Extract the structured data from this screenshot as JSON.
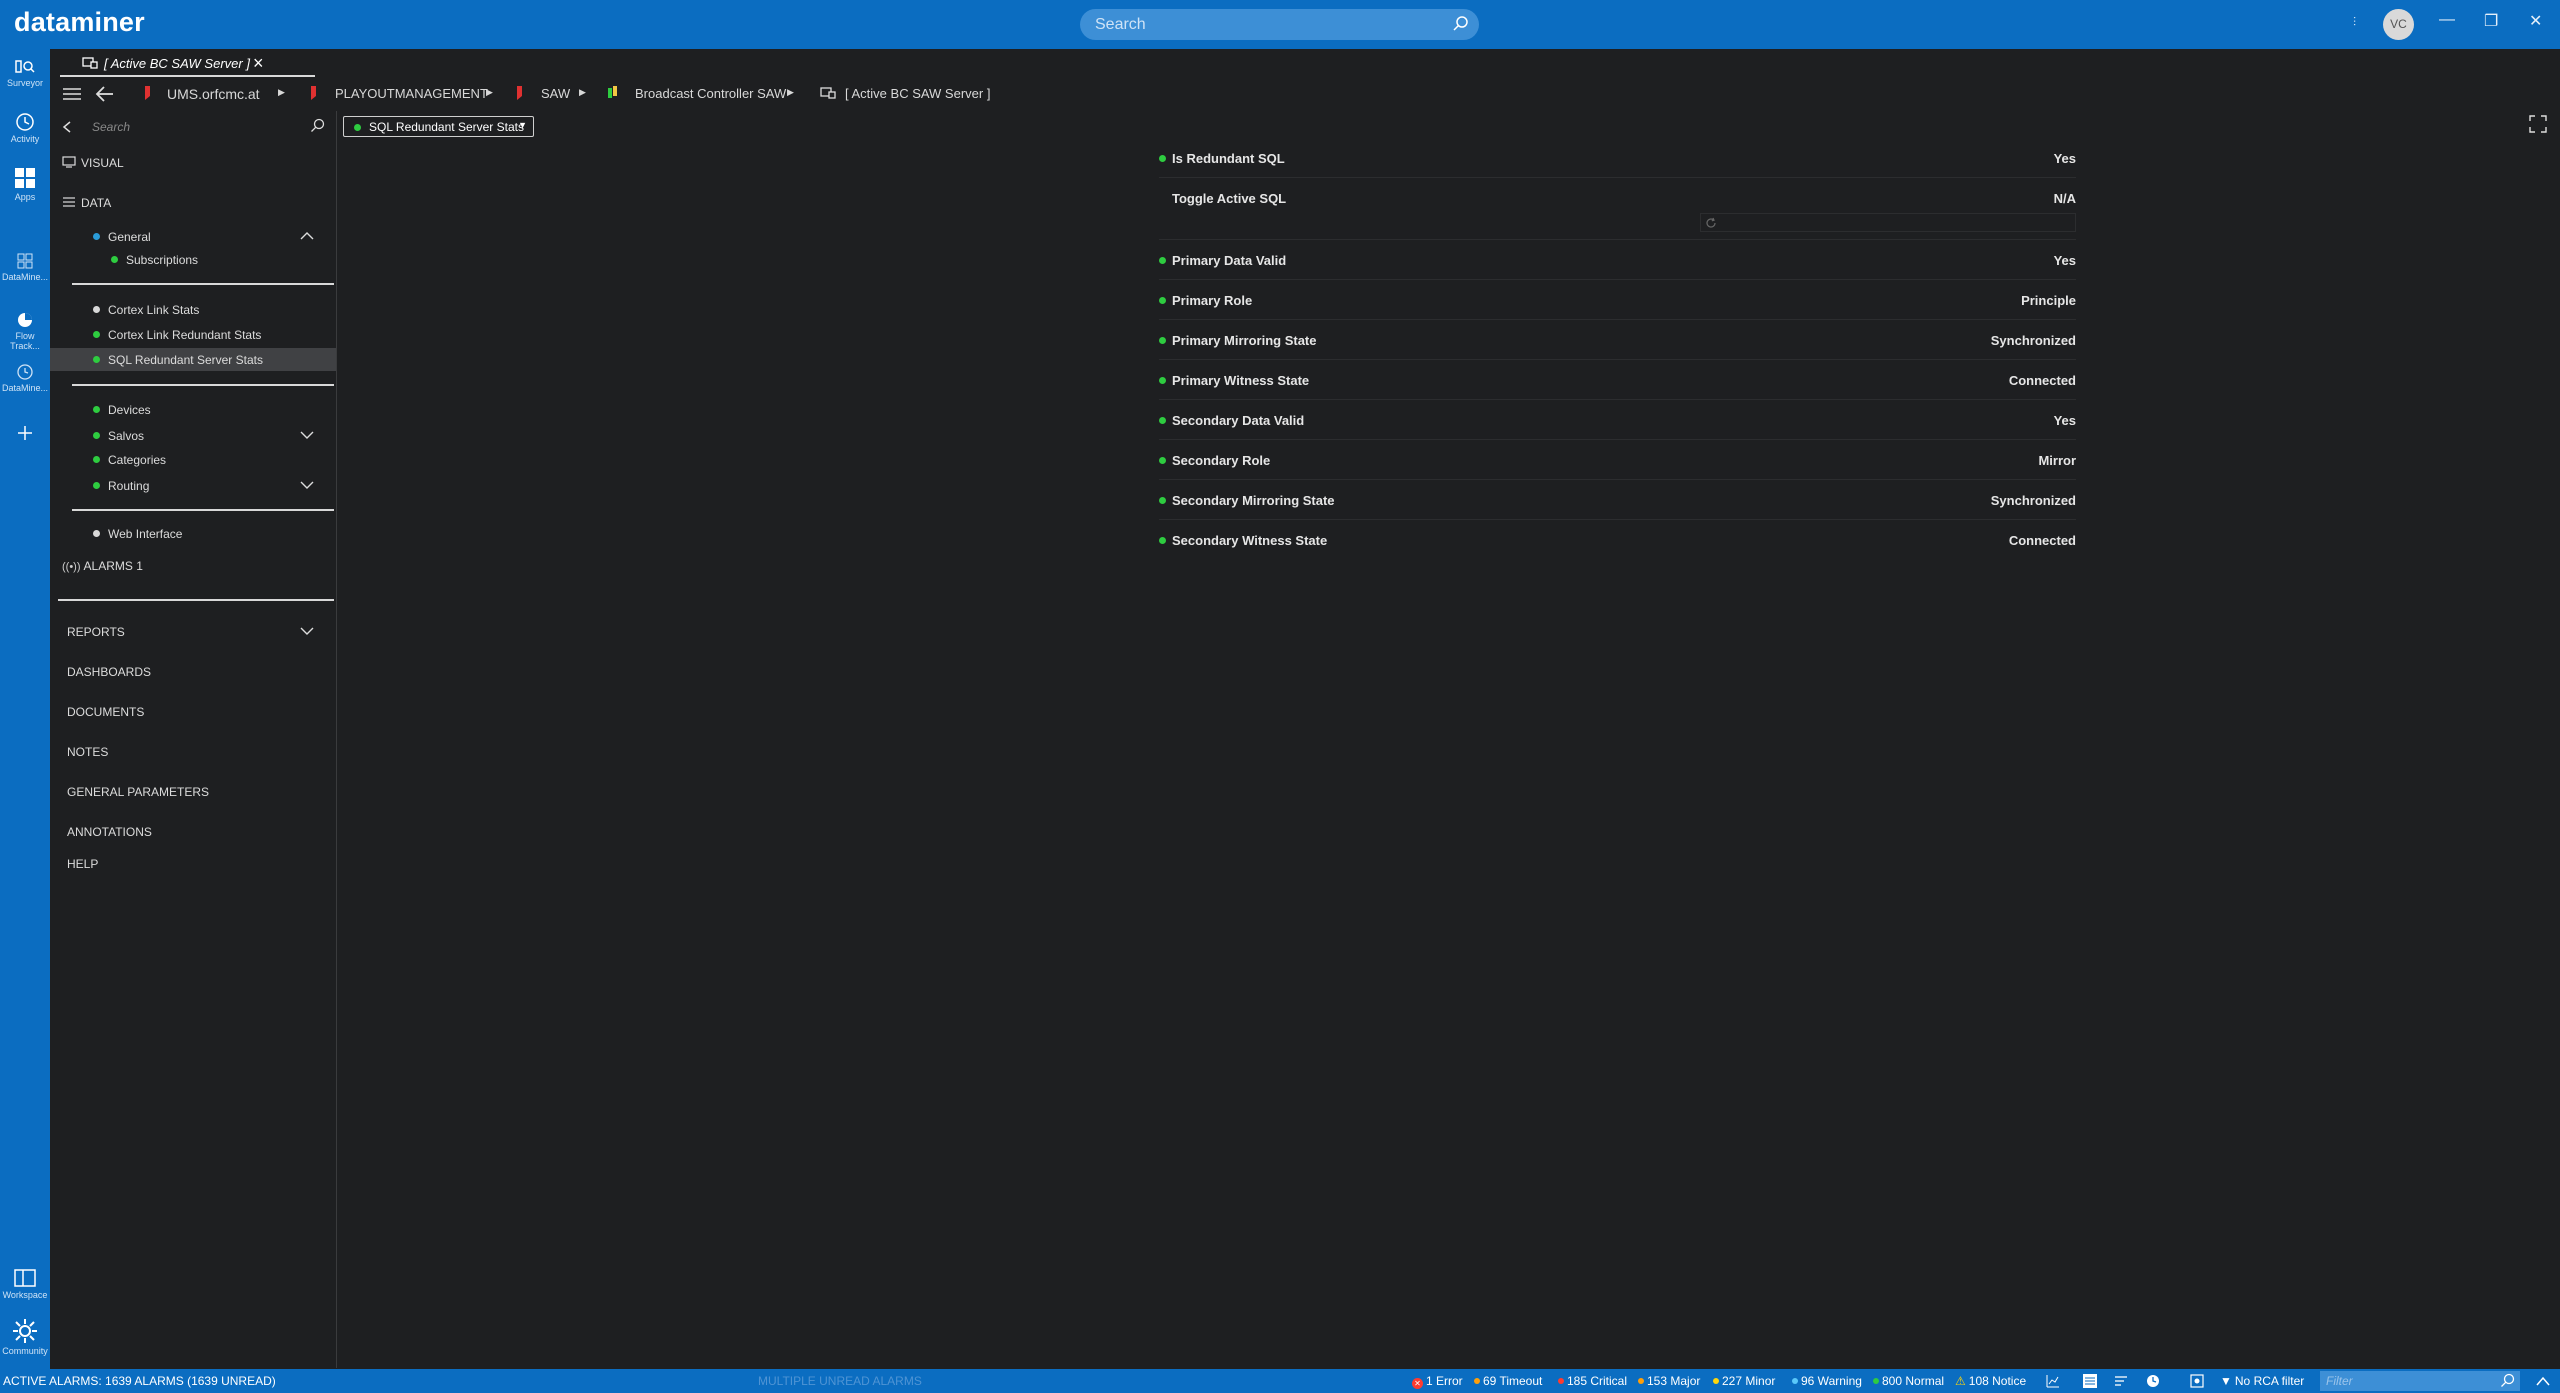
{
  "app": {
    "title": "dataminer",
    "search_placeholder": "Search",
    "user_initials": "VC"
  },
  "leftbar": [
    {
      "label": "Surveyor",
      "icon": "surveyor-icon"
    },
    {
      "label": "Activity",
      "icon": "activity-icon"
    },
    {
      "label": "Apps",
      "icon": "apps-icon"
    },
    {
      "label": "DataMine...",
      "icon": "datamine-apps-icon"
    },
    {
      "label": "Flow Track...",
      "icon": "flow-track-icon"
    },
    {
      "label": "DataMine...",
      "icon": "datamine-clock-icon"
    },
    {
      "label": "",
      "icon": "plus-icon"
    },
    {
      "label": "Workspace",
      "icon": "workspace-icon"
    },
    {
      "label": "Community",
      "icon": "community-icon"
    }
  ],
  "tab": {
    "label": "[ Active BC SAW Server ]"
  },
  "breadcrumb": [
    "UMS.orfcmc.at",
    "PLAYOUTMANAGEMENT",
    "SAW",
    "Broadcast Controller SAW",
    "[ Active BC SAW Server ]"
  ],
  "sidebar": {
    "search_placeholder": "Search",
    "visual": "VISUAL",
    "data": "DATA",
    "general": "General",
    "subscriptions": "Subscriptions",
    "cortex_link_stats": "Cortex Link Stats",
    "cortex_link_redundant_stats": "Cortex Link Redundant Stats",
    "sql_redundant_server_stats": "SQL Redundant Server Stats",
    "devices": "Devices",
    "salvos": "Salvos",
    "categories": "Categories",
    "routing": "Routing",
    "web_interface": "Web Interface",
    "alarms": "ALARMS 1",
    "reports": "REPORTS",
    "dashboards": "DASHBOARDS",
    "documents": "DOCUMENTS",
    "notes": "NOTES",
    "general_parameters": "GENERAL PARAMETERS",
    "annotations": "ANNOTATIONS",
    "help": "HELP"
  },
  "view_select": {
    "value": "SQL Redundant Server Stats"
  },
  "parameters": [
    {
      "name": "Is Redundant SQL",
      "value": "Yes"
    },
    {
      "name": "Toggle Active SQL",
      "value": "N/A"
    },
    {
      "name": "Primary Data Valid",
      "value": "Yes"
    },
    {
      "name": "Primary Role",
      "value": "Principle"
    },
    {
      "name": "Primary Mirroring State",
      "value": "Synchronized"
    },
    {
      "name": "Primary Witness State",
      "value": "Connected"
    },
    {
      "name": "Secondary Data Valid",
      "value": "Yes"
    },
    {
      "name": "Secondary Role",
      "value": "Mirror"
    },
    {
      "name": "Secondary Mirroring State",
      "value": "Synchronized"
    },
    {
      "name": "Secondary Witness State",
      "value": "Connected"
    }
  ],
  "status": {
    "active_alarms": "ACTIVE ALARMS: 1639 ALARMS (1639 UNREAD)",
    "multiple": "MULTIPLE UNREAD ALARMS",
    "error": "1 Error",
    "timeout": "69 Timeout",
    "critical": "185 Critical",
    "major": "153 Major",
    "minor": "227 Minor",
    "warning": "96 Warning",
    "normal": "800 Normal",
    "notice": "108 Notice",
    "rca": "No RCA filter",
    "filter_placeholder": "Filter"
  },
  "colors": {
    "brand": "#0b6dc1",
    "ok": "#2ecc40",
    "critical": "#ff3b30",
    "major": "#ff9f0a",
    "minor": "#ffd60a"
  }
}
